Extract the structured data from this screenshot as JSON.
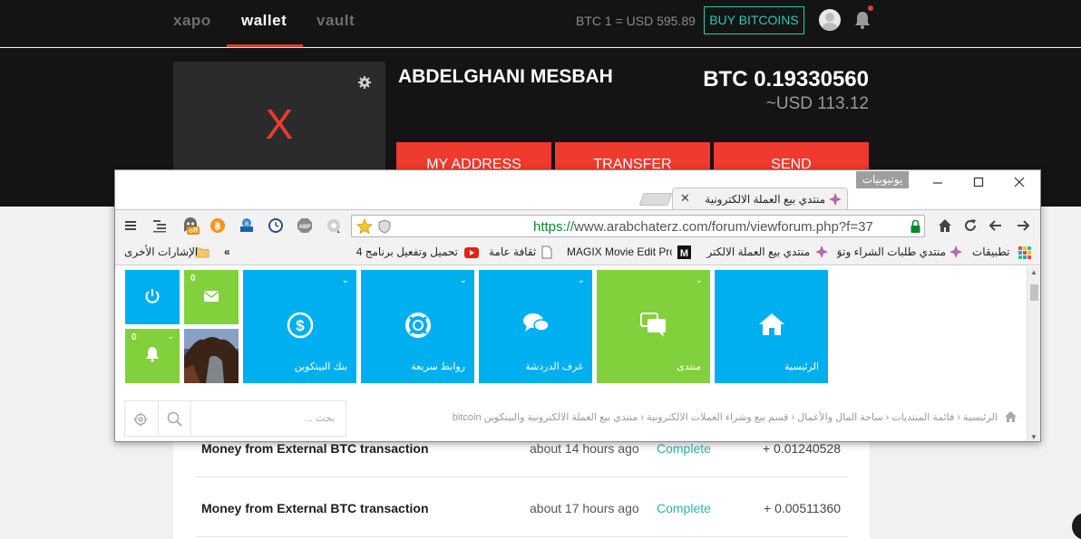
{
  "xapo": {
    "nav": {
      "brand": "xapo",
      "wallet": "wallet",
      "vault": "vault"
    },
    "rate": "BTC 1 = USD 595.89",
    "buy_button": "BUY BITCOINS",
    "card_letter": "X",
    "account_name": "ABDELGHANI MESBAH",
    "btc_balance": "BTC 0.19330560",
    "usd_balance": "~USD 113.12",
    "actions": {
      "address": "MY ADDRESS",
      "transfer": "TRANSFER",
      "send": "SEND"
    },
    "transactions": [
      {
        "description": "Money from External BTC transaction",
        "time": "about 14 hours ago",
        "status": "Complete",
        "amount": "+ 0.01240528"
      },
      {
        "description": "Money from External BTC transaction",
        "time": "about 17 hours ago",
        "status": "Complete",
        "amount": "+ 0.00511360"
      }
    ],
    "colors": {
      "accent": "#ef3b2d",
      "teal": "#2cc7b8",
      "dark": "#141414"
    }
  },
  "browser": {
    "profile": "يوتيوبيات",
    "tab_title": "منتدي بيع العملة الالكترونية",
    "url_scheme": "https://",
    "url_rest": "www.arabchaterz.com/forum/viewforum.php?f=37",
    "extension_badge": "off",
    "bookmarks": {
      "apps": "تطبيقات",
      "b1": "منتدي طلبات الشراء وتق",
      "b2": "منتدي بيع العملة الالكتر",
      "b3": "MAGIX Movie Edit Pro",
      "b4": "ثقافة عامة",
      "b5": "تحميل وتفعيل برنامج 4",
      "more": "»",
      "other": "الإشارات الأخرى"
    }
  },
  "forum": {
    "tiles": {
      "home": "الرئيسية",
      "forum": "منتدى",
      "chat": "غرف الدردشة",
      "links": "روابط سريعة",
      "bank": "بنك البيتكوين"
    },
    "mail_count": "0",
    "bell_count": "0",
    "search_placeholder": "بحث ...",
    "breadcrumb": "الرئيسية  ‹  قائمة المنتديات  ‹  ساحة المال والأعمال  ‹  قسم بيع وشراء العملات الالكترونية  ‹  منتدي بيع العملة الالكترونية والبيتكوين bitcoin",
    "colors": {
      "blue": "#00aff0",
      "green": "#82d03b"
    }
  }
}
